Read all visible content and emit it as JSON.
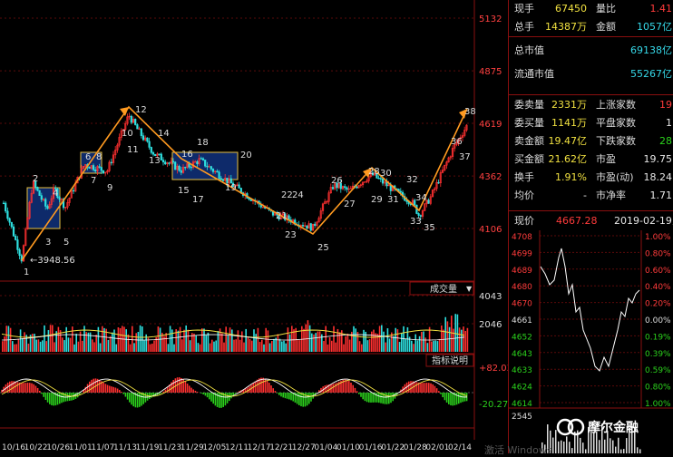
{
  "main_chart": {
    "price_axis": [
      "5132",
      "4875",
      "4619",
      "4362",
      "4106"
    ],
    "volume_axis": [
      "4043",
      "2046"
    ],
    "indicator_axis": [
      "+82.03",
      "-20.27"
    ],
    "dates": [
      "10/16",
      "10/22",
      "10/26",
      "11/01",
      "11/07",
      "11/13",
      "11/19",
      "11/23",
      "11/29",
      "12/05",
      "12/11",
      "12/17",
      "12/21",
      "12/27",
      "01/04",
      "01/10",
      "01/16",
      "01/22",
      "01/28",
      "02/01",
      "02/14"
    ],
    "volume_tab": "成交量",
    "indicator_tab": "指标说明",
    "low_label": "3948.56",
    "wave_labels": [
      "1",
      "2",
      "3",
      "4",
      "5",
      "6",
      "7",
      "8",
      "9",
      "10",
      "11",
      "12",
      "13",
      "14",
      "15",
      "16",
      "17",
      "18",
      "19",
      "20",
      "21",
      "22",
      "23",
      "24",
      "25",
      "26",
      "27",
      "28",
      "29",
      "30",
      "31",
      "32",
      "33",
      "34",
      "35",
      "36",
      "37",
      "38"
    ]
  },
  "quote_panel": {
    "rows": [
      {
        "l1": "现手",
        "v1": "67450",
        "c1": "val-y",
        "l2": "量比",
        "v2": "1.41",
        "c2": "val-r"
      },
      {
        "l1": "总手",
        "v1": "14387万",
        "c1": "val-y",
        "l2": "金额",
        "v2": "1057亿",
        "c2": "val-c"
      },
      {
        "l1": "总市值",
        "v1": "69138亿",
        "c1": "val-c"
      },
      {
        "l1": "流通市值",
        "v1": "55267亿",
        "c1": "val-c"
      },
      {
        "l1": "委卖量",
        "v1": "2331万",
        "c1": "val-y",
        "l2": "上涨家数",
        "v2": "19",
        "c2": "val-r"
      },
      {
        "l1": "委买量",
        "v1": "1141万",
        "c1": "val-y",
        "l2": "平盘家数",
        "v2": "1",
        "c2": "val-w"
      },
      {
        "l1": "卖金额",
        "v1": "19.47亿",
        "c1": "val-y",
        "l2": "下跌家数",
        "v2": "28",
        "c2": "val-g"
      },
      {
        "l1": "买金额",
        "v1": "21.62亿",
        "c1": "val-y",
        "l2": "市盈",
        "v2": "19.75",
        "c2": "val-w"
      },
      {
        "l1": "换手",
        "v1": "1.91%",
        "c1": "val-y",
        "l2": "市盈(动)",
        "v2": "18.24",
        "c2": "val-w"
      },
      {
        "l1": "均价",
        "v1": "-",
        "c1": "val-w",
        "l2": "市净率",
        "v2": "1.71",
        "c2": "val-w"
      }
    ],
    "now_label": "现价",
    "now_value": "4667.28",
    "date_stamp": "2019-02-19,二",
    "intraday_left": [
      "4708",
      "4699",
      "4689",
      "4680",
      "4670",
      "4661",
      "4652",
      "4643",
      "4633",
      "4624",
      "4614"
    ],
    "intraday_right": [
      "1.00%",
      "0.80%",
      "0.60%",
      "0.40%",
      "0.20%",
      "0.00%",
      "0.19%",
      "0.39%",
      "0.59%",
      "0.80%",
      "1.00%"
    ],
    "volume_value": "2545"
  },
  "watermark": {
    "text": "摩尔金融"
  },
  "taskbar_text": "激活 Windows"
}
